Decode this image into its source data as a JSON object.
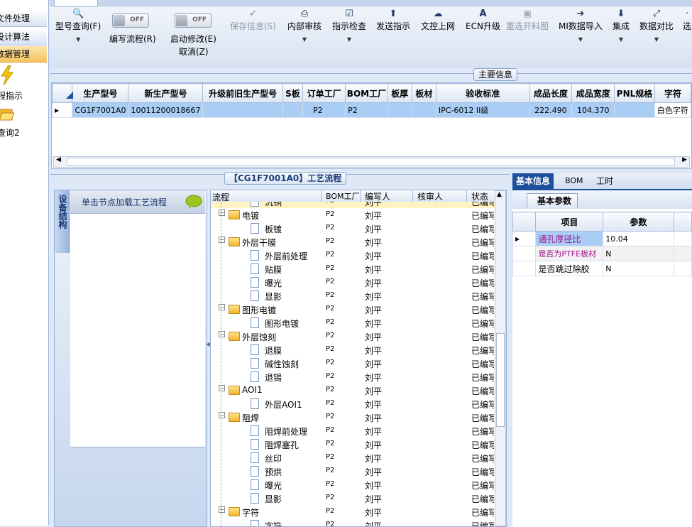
{
  "leftnav": {
    "groups": [
      "文件处理",
      "设计算法",
      "数据管理"
    ],
    "items": [
      {
        "label": "程指示",
        "icon": "lightning-icon"
      },
      {
        "label": "查询2",
        "icon": "folder-open-icon"
      }
    ]
  },
  "toolbar": {
    "buttons": [
      {
        "label": "型号查询(F)",
        "icon": "search-icon",
        "disabled": false,
        "dropdown": true
      },
      {
        "label": "保存信息(S)",
        "icon": "check-icon",
        "disabled": true
      },
      {
        "label": "内部审核",
        "icon": "printer-icon",
        "disabled": false,
        "dropdown": true
      },
      {
        "label": "指示检查",
        "icon": "checkbox-icon",
        "disabled": false,
        "dropdown": true
      },
      {
        "label": "发送指示",
        "icon": "upload-icon",
        "disabled": false
      },
      {
        "label": "文控上网",
        "icon": "cloud-upload-icon",
        "disabled": false
      },
      {
        "label": "ECN升级",
        "icon": "ecn-icon",
        "disabled": false
      },
      {
        "label": "重选开料图",
        "icon": "image-icon",
        "disabled": true
      },
      {
        "label": "MI数据导入",
        "icon": "import-icon",
        "disabled": false,
        "dropdown": true
      },
      {
        "label": "集成",
        "icon": "download-icon",
        "disabled": false,
        "dropdown": true
      },
      {
        "label": "数据对比",
        "icon": "compare-icon",
        "disabled": false,
        "dropdown": true
      },
      {
        "label": "选",
        "icon": "more-icon",
        "disabled": false
      }
    ],
    "toggles": [
      {
        "state": "OFF",
        "label": "编写流程(R)"
      },
      {
        "state": "OFF",
        "label": "启动修改(E)",
        "label2": "取消(Z)"
      }
    ]
  },
  "main_info": {
    "title": "主要信息",
    "columns": [
      "生产型号",
      "新生产型号",
      "升级前旧生产型号",
      "S板",
      "订单工厂",
      "BOM工厂",
      "板厚",
      "板材",
      "验收标准",
      "成品长度",
      "成品宽度",
      "PNL规格",
      "字符"
    ],
    "rows": [
      [
        "CG1F7001A0",
        "10011200018667",
        "",
        "",
        "P2",
        "P2",
        "",
        "",
        "IPC-6012 II级",
        "222.490",
        "104.370",
        "",
        "白色字符"
      ]
    ]
  },
  "process": {
    "title": "【CG1F7001A0】工艺流程",
    "side_tab": "设备结构",
    "hint": "单击节点加载工艺流程",
    "columns": [
      "流程",
      "BOM工厂",
      "编写人",
      "核审人",
      "状态"
    ],
    "rows": [
      {
        "name": "沉铜",
        "level": 2,
        "factory": "P2",
        "writer": "刘平",
        "reviewer": "",
        "status": "已编写"
      },
      {
        "name": "电镀",
        "level": 1,
        "factory": "P2",
        "writer": "刘平",
        "reviewer": "",
        "status": "已编写"
      },
      {
        "name": "板镀",
        "level": 2,
        "factory": "P2",
        "writer": "刘平",
        "reviewer": "",
        "status": "已编写"
      },
      {
        "name": "外层干膜",
        "level": 1,
        "factory": "P2",
        "writer": "刘平",
        "reviewer": "",
        "status": "已编写"
      },
      {
        "name": "外层前处理",
        "level": 2,
        "factory": "P2",
        "writer": "刘平",
        "reviewer": "",
        "status": "已编写"
      },
      {
        "name": "贴膜",
        "level": 2,
        "factory": "P2",
        "writer": "刘平",
        "reviewer": "",
        "status": "已编写"
      },
      {
        "name": "曝光",
        "level": 2,
        "factory": "P2",
        "writer": "刘平",
        "reviewer": "",
        "status": "已编写"
      },
      {
        "name": "显影",
        "level": 2,
        "factory": "P2",
        "writer": "刘平",
        "reviewer": "",
        "status": "已编写"
      },
      {
        "name": "图形电镀",
        "level": 1,
        "factory": "P2",
        "writer": "刘平",
        "reviewer": "",
        "status": "已编写"
      },
      {
        "name": "图形电镀",
        "level": 2,
        "factory": "P2",
        "writer": "刘平",
        "reviewer": "",
        "status": "已编写"
      },
      {
        "name": "外层蚀刻",
        "level": 1,
        "factory": "P2",
        "writer": "刘平",
        "reviewer": "",
        "status": "已编写"
      },
      {
        "name": "退膜",
        "level": 2,
        "factory": "P2",
        "writer": "刘平",
        "reviewer": "",
        "status": "已编写"
      },
      {
        "name": "碱性蚀刻",
        "level": 2,
        "factory": "P2",
        "writer": "刘平",
        "reviewer": "",
        "status": "已编写"
      },
      {
        "name": "退锡",
        "level": 2,
        "factory": "P2",
        "writer": "刘平",
        "reviewer": "",
        "status": "已编写"
      },
      {
        "name": "AOI1",
        "level": 1,
        "factory": "P2",
        "writer": "刘平",
        "reviewer": "",
        "status": "已编写"
      },
      {
        "name": "外层AOI1",
        "level": 2,
        "factory": "P2",
        "writer": "刘平",
        "reviewer": "",
        "status": "已编写"
      },
      {
        "name": "阻焊",
        "level": 1,
        "factory": "P2",
        "writer": "刘平",
        "reviewer": "",
        "status": "已编写"
      },
      {
        "name": "阻焊前处理",
        "level": 2,
        "factory": "P2",
        "writer": "刘平",
        "reviewer": "",
        "status": "已编写"
      },
      {
        "name": "阻焊塞孔",
        "level": 2,
        "factory": "P2",
        "writer": "刘平",
        "reviewer": "",
        "status": "已编写"
      },
      {
        "name": "丝印",
        "level": 2,
        "factory": "P2",
        "writer": "刘平",
        "reviewer": "",
        "status": "已编写"
      },
      {
        "name": "预烘",
        "level": 2,
        "factory": "P2",
        "writer": "刘平",
        "reviewer": "",
        "status": "已编写"
      },
      {
        "name": "曝光",
        "level": 2,
        "factory": "P2",
        "writer": "刘平",
        "reviewer": "",
        "status": "已编写"
      },
      {
        "name": "显影",
        "level": 2,
        "factory": "P2",
        "writer": "刘平",
        "reviewer": "",
        "status": "已编写"
      },
      {
        "name": "字符",
        "level": 1,
        "factory": "P2",
        "writer": "刘平",
        "reviewer": "",
        "status": "已编写"
      },
      {
        "name": "字符",
        "level": 2,
        "factory": "P2",
        "writer": "刘平",
        "reviewer": "",
        "status": "已编写"
      }
    ]
  },
  "detail": {
    "tabs": [
      "基本信息",
      "BOM",
      "工时"
    ],
    "subtab": "基本参数",
    "columns": [
      "项目",
      "参数"
    ],
    "rows": [
      {
        "item": "通孔厚径比",
        "value": "10.04",
        "color": "#a0148c"
      },
      {
        "item": "是否为PTFE板材",
        "value": "N",
        "color": "#a0148c"
      },
      {
        "item": "是否跳过除胶",
        "value": "N",
        "color": "#000000"
      }
    ]
  },
  "colors": {
    "selection": "#a9cdf5",
    "accent": "#1c4f9c",
    "folder": "#f2b630"
  }
}
